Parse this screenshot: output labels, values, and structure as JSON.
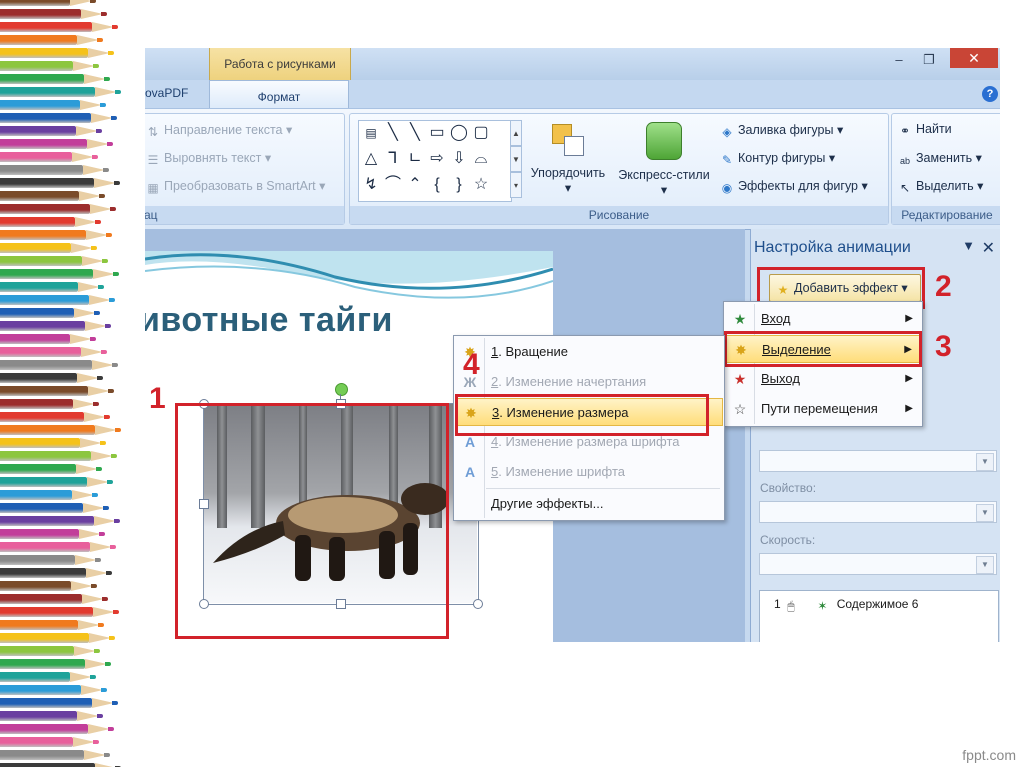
{
  "window": {
    "context_group": "Работа с рисунками",
    "tab_left": "ovaPDF",
    "tab_active": "Формат",
    "minimize": "–",
    "restore": "❐",
    "close": "✕",
    "help": "?"
  },
  "ribbon": {
    "text_group": {
      "direction": "Направление текста",
      "align": "Выровнять текст",
      "smartart": "Преобразовать в SmartArt",
      "label": "ац"
    },
    "drawing": {
      "arrange": "Упорядочить",
      "quick_styles": "Экспресс-стили",
      "fill": "Заливка фигуры",
      "outline": "Контур фигуры",
      "effects": "Эффекты для фигур",
      "label": "Рисование"
    },
    "editing": {
      "find": "Найти",
      "replace": "Заменить",
      "select": "Выделить",
      "label": "Редактирование"
    }
  },
  "slide": {
    "title": "ивотные тайги"
  },
  "panel": {
    "title": "Настройка анимации",
    "add_effect": "Добавить эффект",
    "property_label": "Свойство:",
    "speed_label": "Скорость:",
    "list_item_num": "1",
    "list_item_text": "Содержимое 6"
  },
  "menu_main": {
    "items": [
      {
        "label": "Вход",
        "icon": "entrance-star-icon"
      },
      {
        "label": "Выделение",
        "icon": "emphasis-star-icon"
      },
      {
        "label": "Выход",
        "icon": "exit-star-icon"
      },
      {
        "label": "Пути перемещения",
        "icon": "motion-path-star-icon"
      }
    ]
  },
  "menu_sub": {
    "items": [
      {
        "key": "1",
        "label": ". Вращение",
        "enabled": true
      },
      {
        "key": "2",
        "label": ". Изменение начертания",
        "enabled": false
      },
      {
        "key": "3",
        "label": ". Изменение размера",
        "enabled": true
      },
      {
        "key": "4",
        "label": ". Изменение размера шрифта",
        "enabled": false
      },
      {
        "key": "5",
        "label": ". Изменение шрифта",
        "enabled": false
      }
    ],
    "more": "Другие эффекты..."
  },
  "annotations": [
    "1",
    "2",
    "3",
    "4"
  ],
  "watermark": "fppt.com",
  "colors": {
    "annotation_red": "#d2222a",
    "highlight": "#ffdd7a",
    "ribbon_blue": "#c6d9ef"
  }
}
